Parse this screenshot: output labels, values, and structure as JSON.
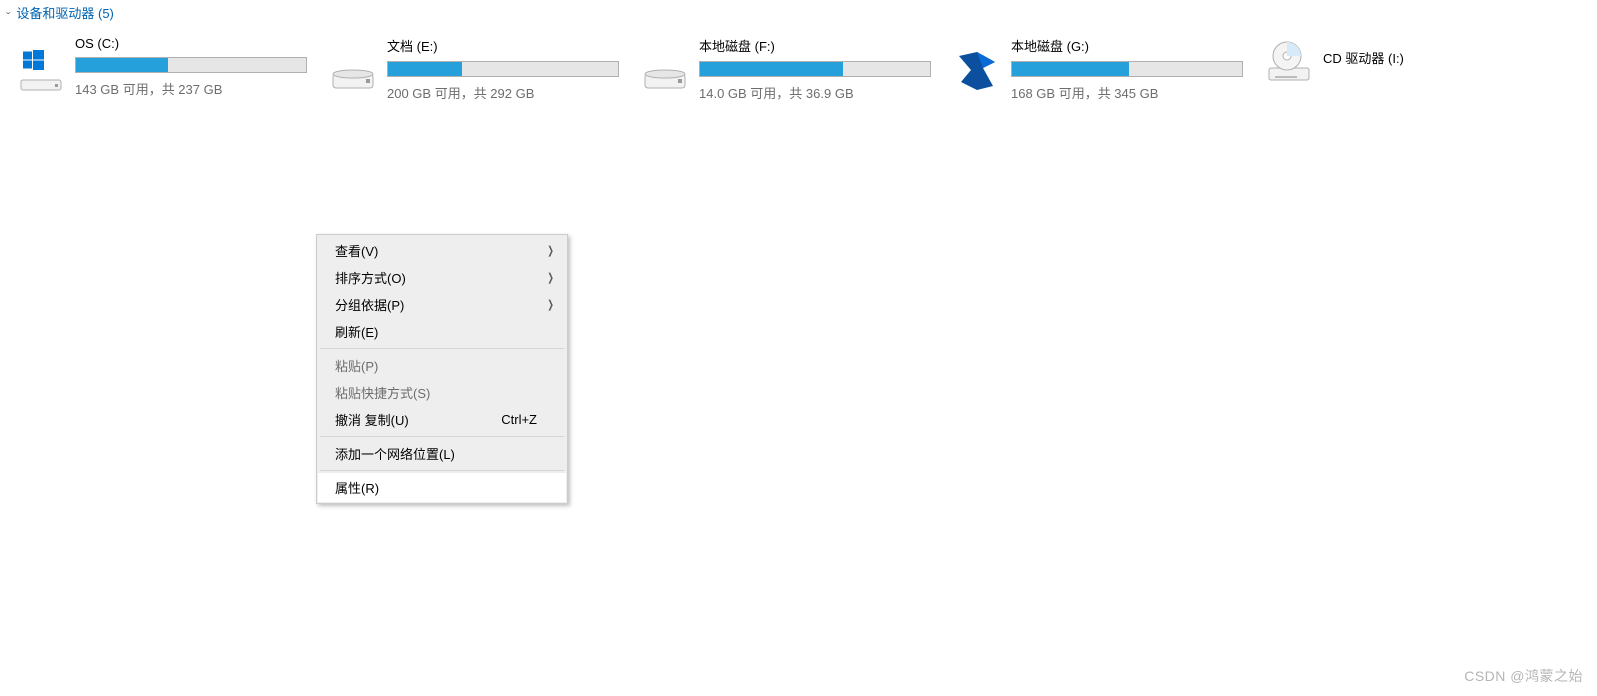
{
  "section": {
    "title": "设备和驱动器 (5)"
  },
  "drives": [
    {
      "name": "OS (C:)",
      "sub": "143 GB 可用，共 237 GB",
      "fill": 40,
      "icon": "windows",
      "has_bar": true
    },
    {
      "name": "文档 (E:)",
      "sub": "200 GB 可用，共 292 GB",
      "fill": 32,
      "icon": "hdd",
      "has_bar": true
    },
    {
      "name": "本地磁盘 (F:)",
      "sub": "14.0 GB 可用，共 36.9 GB",
      "fill": 62,
      "icon": "hdd",
      "has_bar": true
    },
    {
      "name": "本地磁盘 (G:)",
      "sub": "168 GB 可用，共 345 GB",
      "fill": 51,
      "icon": "bird",
      "has_bar": true
    },
    {
      "name": "CD 驱动器 (I:)",
      "sub": "",
      "fill": 0,
      "icon": "cd",
      "has_bar": false
    }
  ],
  "context_menu": {
    "items": [
      {
        "label": "查看(V)",
        "submenu": true
      },
      {
        "label": "排序方式(O)",
        "submenu": true
      },
      {
        "label": "分组依据(P)",
        "submenu": true
      },
      {
        "label": "刷新(E)"
      },
      {
        "sep": true
      },
      {
        "label": "粘贴(P)",
        "disabled": true
      },
      {
        "label": "粘贴快捷方式(S)",
        "disabled": true
      },
      {
        "label": "撤消 复制(U)",
        "shortcut": "Ctrl+Z"
      },
      {
        "sep": true
      },
      {
        "label": "添加一个网络位置(L)"
      },
      {
        "sep": true
      },
      {
        "label": "属性(R)",
        "hover": true
      }
    ]
  },
  "watermark": "CSDN @鸿蒙之始"
}
